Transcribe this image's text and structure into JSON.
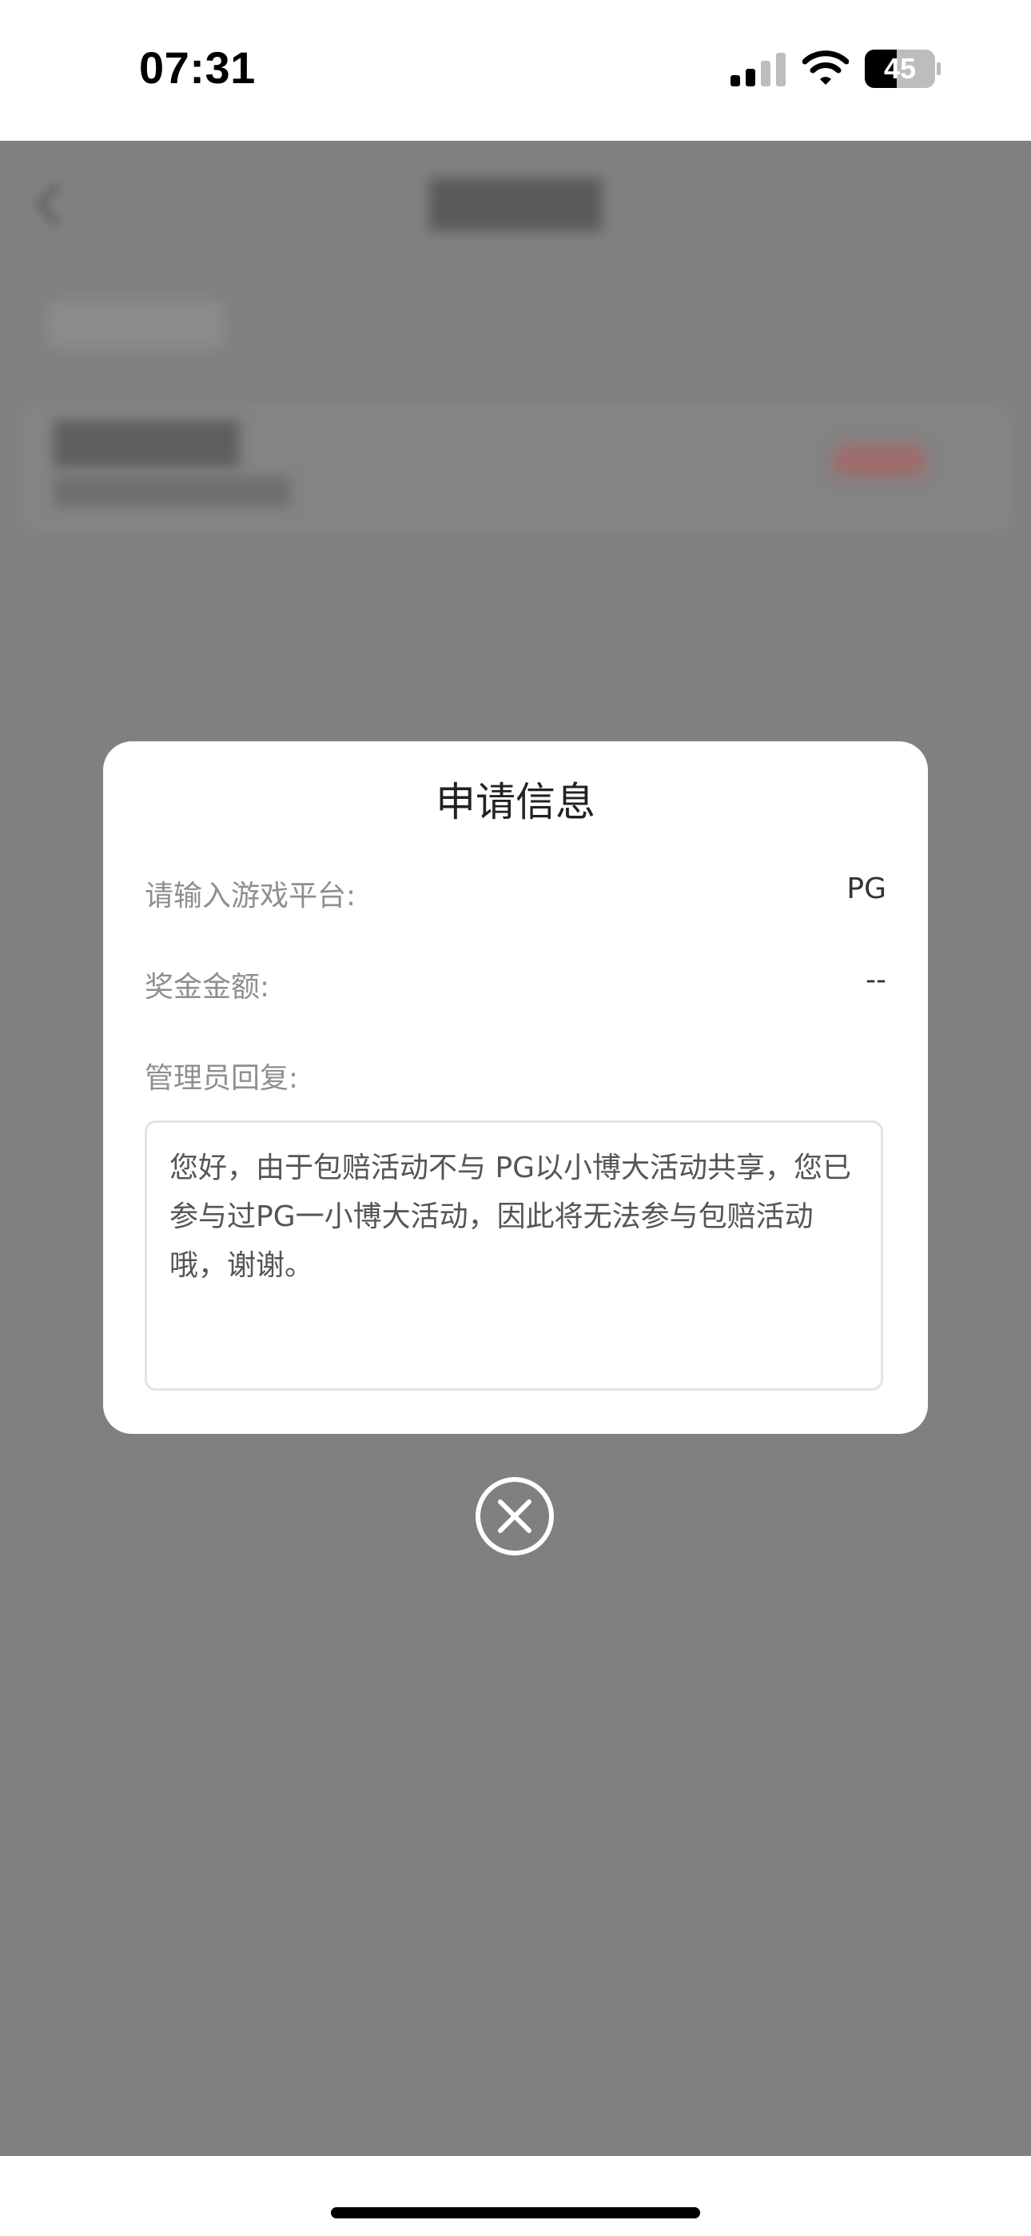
{
  "status_bar": {
    "time": "07:31",
    "battery": "45",
    "icons": [
      "signal-icon",
      "wifi-icon",
      "battery-icon"
    ]
  },
  "modal": {
    "title": "申请信息",
    "fields": [
      {
        "label": "请输入游戏平台:",
        "value": "PG"
      },
      {
        "label": "奖金金额:",
        "value": "--"
      }
    ],
    "reply_label": "管理员回复:",
    "reply_text": "您好，由于包赔活动不与 PG以小博大活动共享，您已参与过PG一小博大活动，因此将无法参与包赔活动哦，谢谢。"
  },
  "close_icon": "close-circle-icon",
  "colors": {
    "overlay": "#808080",
    "modal_bg": "#ffffff",
    "label": "#8f8f8f",
    "value": "#333333",
    "title": "#222222"
  }
}
